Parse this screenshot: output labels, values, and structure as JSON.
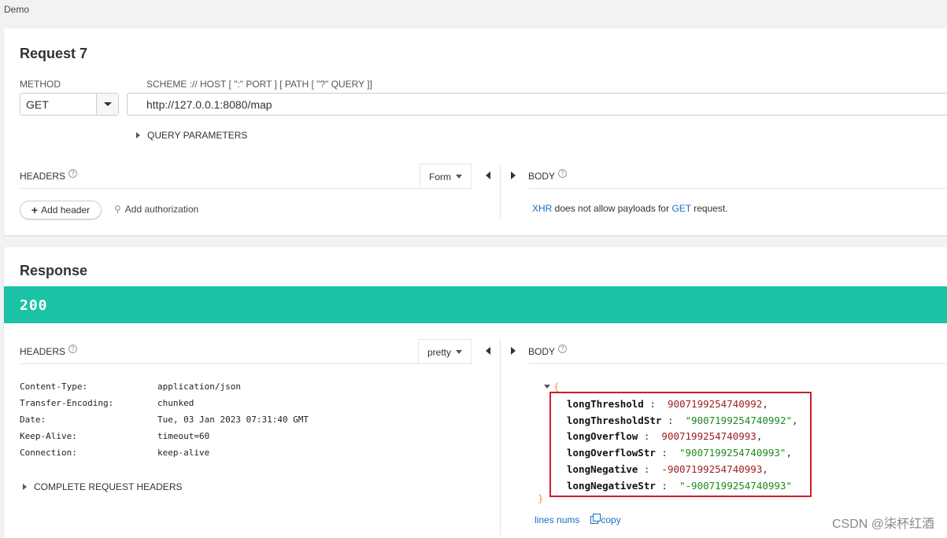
{
  "app_title": "Demo",
  "request": {
    "title": "Request 7",
    "method_label": "METHOD",
    "method_value": "GET",
    "url_label": "SCHEME :// HOST [ \":\" PORT ] [ PATH [ \"?\" QUERY ]]",
    "url_value": "http://127.0.0.1:8080/map",
    "query_params_label": "QUERY PARAMETERS",
    "headers_label": "HEADERS",
    "headers_format": "Form",
    "body_label": "BODY",
    "add_header_label": "Add header",
    "add_authorization_label": "Add authorization",
    "body_note": {
      "xhr": "XHR",
      "middle": " does not allow payloads for ",
      "method": "GET",
      "end": " request."
    }
  },
  "response": {
    "title": "Response",
    "status_code": "200",
    "status_color": "#1cc2a5",
    "headers_label": "HEADERS",
    "headers_format": "pretty",
    "body_label": "BODY",
    "headers": [
      {
        "key": "Content-Type:",
        "value": "application/json"
      },
      {
        "key": "Transfer-Encoding:",
        "value": "chunked"
      },
      {
        "key": "Date:",
        "value": "Tue, 03 Jan 2023 07:31:40 GMT"
      },
      {
        "key": "Keep-Alive:",
        "value": "timeout=60"
      },
      {
        "key": "Connection:",
        "value": "keep-alive"
      }
    ],
    "complete_request_headers_label": "COMPLETE REQUEST HEADERS",
    "json_open": "{",
    "json_close": "}",
    "json_fields": [
      {
        "key": "longThreshold",
        "value": "9007199254740992",
        "suffix": ","
      },
      {
        "key": "longThresholdStr",
        "value": "\"9007199254740992\"",
        "suffix": ","
      },
      {
        "key": "longOverflow",
        "value": "9007199254740993",
        "suffix": ","
      },
      {
        "key": "longOverflowStr",
        "value": "\"9007199254740993\"",
        "suffix": ","
      },
      {
        "key": "longNegative",
        "value": "-9007199254740993",
        "suffix": ","
      },
      {
        "key": "longNegativeStr",
        "value": "\"-9007199254740993\"",
        "suffix": ""
      }
    ],
    "line_nums_label": "lines nums",
    "copy_label": "copy"
  },
  "watermark": "CSDN @柒杯红酒",
  "icons": {
    "help": "help-circle-icon",
    "key": "key-icon",
    "plus": "plus-icon",
    "copy": "copy-icon"
  }
}
